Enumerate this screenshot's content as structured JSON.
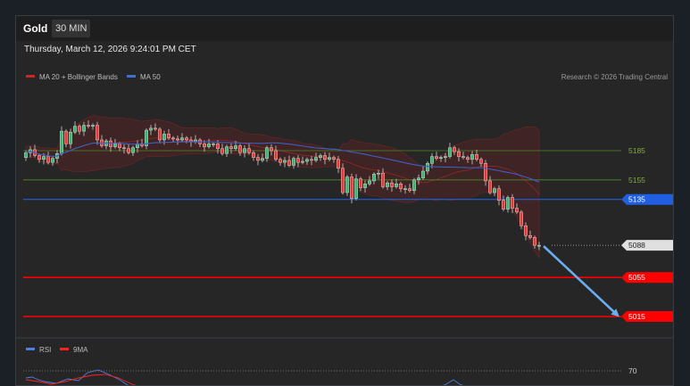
{
  "header": {
    "symbol": "Gold",
    "interval": "30 MIN",
    "datetime": "Thursday, March 12, 2026 9:24:01 PM CET"
  },
  "copyright": "Research © 2026 Trading Central",
  "colors": {
    "bull": "#3cb371",
    "bear": "#e53935",
    "ma50": "#3f5fc4",
    "support": "#ff0000",
    "pivot": "#1f5fe0",
    "resistance": "#4c8a26",
    "arrow": "#6aaef0"
  },
  "chart_data": [
    {
      "type": "candlestick",
      "legend": [
        {
          "name": "MA 20 + Bollinger Bands",
          "color": "#c62828"
        },
        {
          "name": "MA 50",
          "color": "#3f6fd1"
        }
      ],
      "ylim": [
        5005,
        5235
      ],
      "levels": [
        {
          "value": 5185,
          "label": "5185",
          "role": "resistance"
        },
        {
          "value": 5155,
          "label": "5155",
          "role": "resistance"
        },
        {
          "value": 5135,
          "label": "5135",
          "role": "pivot"
        },
        {
          "value": 5088,
          "label": "5088",
          "role": "current"
        },
        {
          "value": 5055,
          "label": "5055",
          "role": "support"
        },
        {
          "value": 5015,
          "label": "5015",
          "role": "support"
        }
      ],
      "close": [
        5183,
        5186,
        5180,
        5176,
        5179,
        5173,
        5177,
        5182,
        5205,
        5192,
        5204,
        5210,
        5205,
        5211,
        5210,
        5211,
        5196,
        5190,
        5195,
        5189,
        5192,
        5188,
        5187,
        5183,
        5188,
        5192,
        5190,
        5206,
        5208,
        5207,
        5196,
        5202,
        5198,
        5197,
        5196,
        5198,
        5196,
        5194,
        5196,
        5192,
        5189,
        5192,
        5192,
        5187,
        5182,
        5189,
        5187,
        5190,
        5183,
        5187,
        5183,
        5178,
        5175,
        5177,
        5188,
        5185,
        5176,
        5173,
        5175,
        5170,
        5177,
        5173,
        5174,
        5176,
        5175,
        5178,
        5180,
        5176,
        5178,
        5176,
        5167,
        5142,
        5158,
        5136,
        5156,
        5147,
        5151,
        5154,
        5161,
        5162,
        5148,
        5152,
        5148,
        5151,
        5146,
        5146,
        5144,
        5155,
        5157,
        5164,
        5172,
        5179,
        5177,
        5178,
        5179,
        5188,
        5184,
        5179,
        5178,
        5176,
        5181,
        5176,
        5172,
        5154,
        5142,
        5146,
        5134,
        5125,
        5137,
        5126,
        5122,
        5108,
        5098,
        5096,
        5088,
        5088
      ],
      "open": [
        5178,
        5183,
        5186,
        5180,
        5176,
        5179,
        5173,
        5177,
        5182,
        5205,
        5192,
        5204,
        5210,
        5205,
        5211,
        5210,
        5211,
        5196,
        5190,
        5195,
        5189,
        5192,
        5188,
        5187,
        5183,
        5188,
        5192,
        5190,
        5206,
        5208,
        5207,
        5196,
        5202,
        5198,
        5197,
        5196,
        5198,
        5196,
        5194,
        5196,
        5192,
        5189,
        5192,
        5192,
        5187,
        5182,
        5189,
        5187,
        5190,
        5183,
        5187,
        5183,
        5178,
        5175,
        5177,
        5188,
        5185,
        5176,
        5173,
        5175,
        5170,
        5177,
        5173,
        5174,
        5176,
        5175,
        5178,
        5180,
        5176,
        5178,
        5176,
        5167,
        5142,
        5158,
        5136,
        5156,
        5147,
        5151,
        5154,
        5161,
        5162,
        5148,
        5152,
        5148,
        5151,
        5146,
        5146,
        5144,
        5155,
        5157,
        5164,
        5172,
        5179,
        5177,
        5178,
        5179,
        5188,
        5184,
        5179,
        5178,
        5176,
        5181,
        5176,
        5172,
        5154,
        5142,
        5146,
        5134,
        5125,
        5137,
        5126,
        5122,
        5108,
        5098,
        5096,
        5088
      ]
    },
    {
      "type": "line",
      "legend": [
        {
          "name": "RSI",
          "color": "#4f7fe0"
        },
        {
          "name": "9MA",
          "color": "#ff2020"
        }
      ],
      "levels": [
        {
          "value": 70,
          "label": "70"
        }
      ]
    }
  ]
}
